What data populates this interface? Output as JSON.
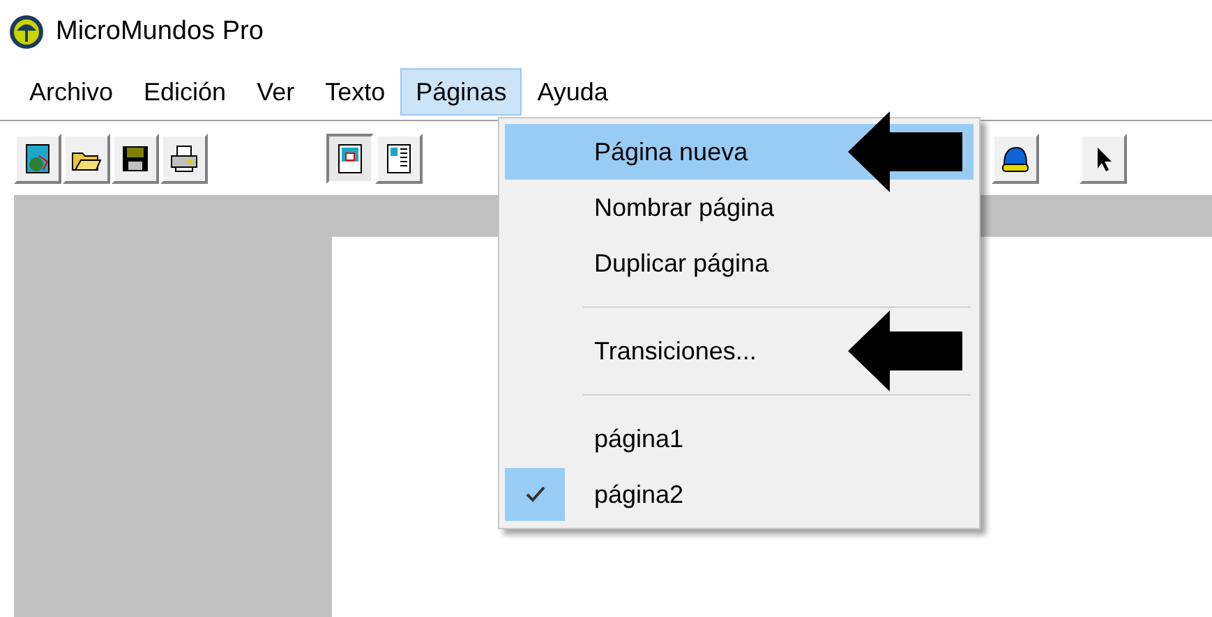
{
  "window": {
    "title": "MicroMundos Pro"
  },
  "menu_bar": [
    {
      "label": "Archivo",
      "selected": false
    },
    {
      "label": "Edición",
      "selected": false
    },
    {
      "label": "Ver",
      "selected": false
    },
    {
      "label": "Texto",
      "selected": false
    },
    {
      "label": "Páginas",
      "selected": true
    },
    {
      "label": "Ayuda",
      "selected": false
    }
  ],
  "toolbar": [
    {
      "kind": "new"
    },
    {
      "kind": "open"
    },
    {
      "kind": "save"
    },
    {
      "kind": "print"
    },
    {
      "kind": "gap"
    },
    {
      "kind": "page-view",
      "pressed": true
    },
    {
      "kind": "text-view",
      "pressed": false
    }
  ],
  "toolbar_right": [
    {
      "kind": "turtle"
    },
    {
      "kind": "pointer"
    }
  ],
  "menu": [
    {
      "kind": "item",
      "label": "Página nueva",
      "selected": true,
      "annotated": true
    },
    {
      "kind": "item",
      "label": "Nombrar página",
      "selected": false,
      "annotated": false
    },
    {
      "kind": "item",
      "label": "Duplicar página",
      "selected": false,
      "annotated": false
    },
    {
      "kind": "separator"
    },
    {
      "kind": "item",
      "label": "Transiciones...",
      "selected": false,
      "annotated": true
    },
    {
      "kind": "separator"
    },
    {
      "kind": "page",
      "label": "página1",
      "checked": false
    },
    {
      "kind": "page",
      "label": "página2",
      "checked": true
    }
  ]
}
